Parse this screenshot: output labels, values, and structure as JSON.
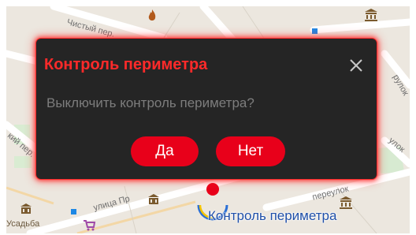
{
  "map": {
    "streets": [
      "Чистый пер.",
      "переулок",
      "улица Пр",
      "кий пер.",
      "рулок",
      "улок"
    ],
    "district": "Усадьба",
    "caption": "Контроль периметра",
    "icons": [
      "museum-icon",
      "fire-icon",
      "bank-icon",
      "shop-icon",
      "location-pin-icon"
    ]
  },
  "dialog": {
    "title": "Контроль периметра",
    "message": "Выключить контроль периметра?",
    "close_icon": "close-icon",
    "yes_label": "Да",
    "no_label": "Нет"
  },
  "colors": {
    "accent": "#e8001a",
    "title": "#ff2a2a",
    "dialog_bg": "#252525",
    "glow": "#ff2b2b"
  }
}
